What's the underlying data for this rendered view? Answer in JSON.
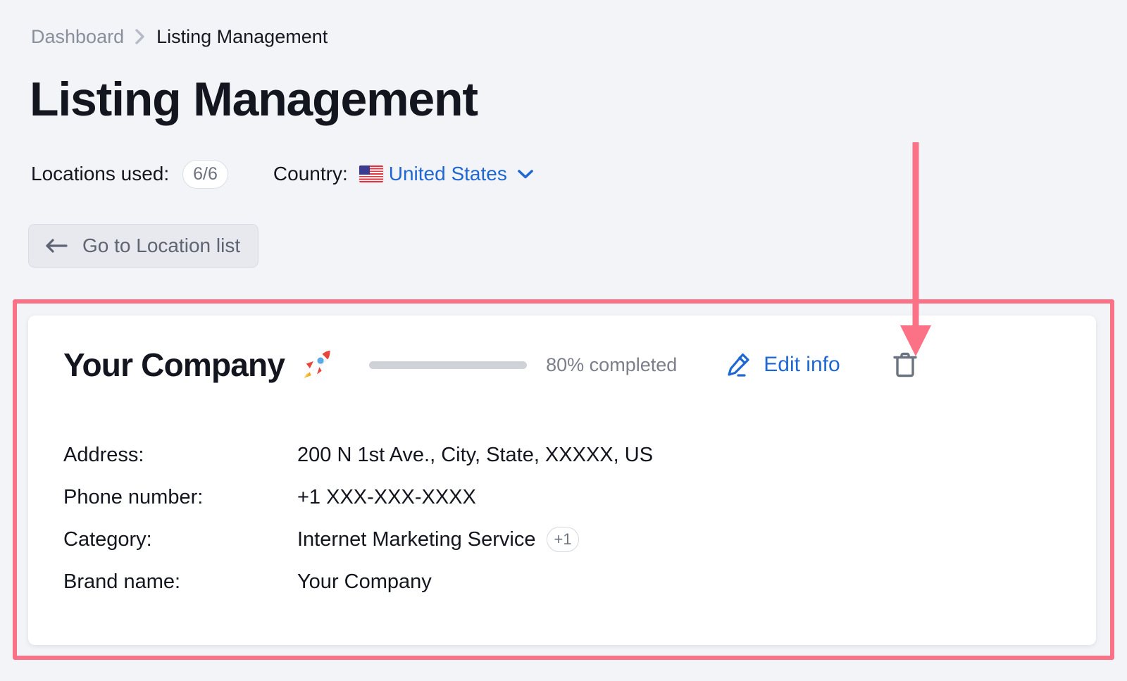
{
  "breadcrumb": {
    "parent": "Dashboard",
    "separator_icon": "chevron-right-icon",
    "current": "Listing Management"
  },
  "page": {
    "title": "Listing Management"
  },
  "meta": {
    "locations_label": "Locations used:",
    "locations_value": "6/6",
    "country_label": "Country:",
    "country_flag_icon": "us-flag-icon",
    "country_value": "United States",
    "country_dropdown_icon": "chevron-down-icon"
  },
  "back_button": {
    "icon": "arrow-left-icon",
    "label": "Go to Location list"
  },
  "card": {
    "company_name": "Your Company",
    "company_badge_icon": "rocket-icon",
    "progress_percent": 80,
    "progress_label": "80% completed",
    "edit_icon": "pencil-icon",
    "edit_label": "Edit info",
    "delete_icon": "trash-icon",
    "details": [
      {
        "label": "Address:",
        "value": "200 N 1st Ave., City, State, XXXXX, US",
        "extra": ""
      },
      {
        "label": "Phone number:",
        "value": "+1 XXX-XXX-XXXX",
        "extra": ""
      },
      {
        "label": "Category:",
        "value": "Internet Marketing Service",
        "extra": "+1"
      },
      {
        "label": "Brand name:",
        "value": "Your Company",
        "extra": ""
      }
    ]
  },
  "annotations": {
    "highlight_color": "#fb7185",
    "arrow_color": "#fb7185",
    "arrow_icon": "down-arrow-annotation"
  },
  "colors": {
    "background": "#f2f4f8",
    "accent_link": "#1f67d2",
    "progress": "#48a178",
    "text": "#14161f",
    "muted": "#8a8f9c"
  }
}
